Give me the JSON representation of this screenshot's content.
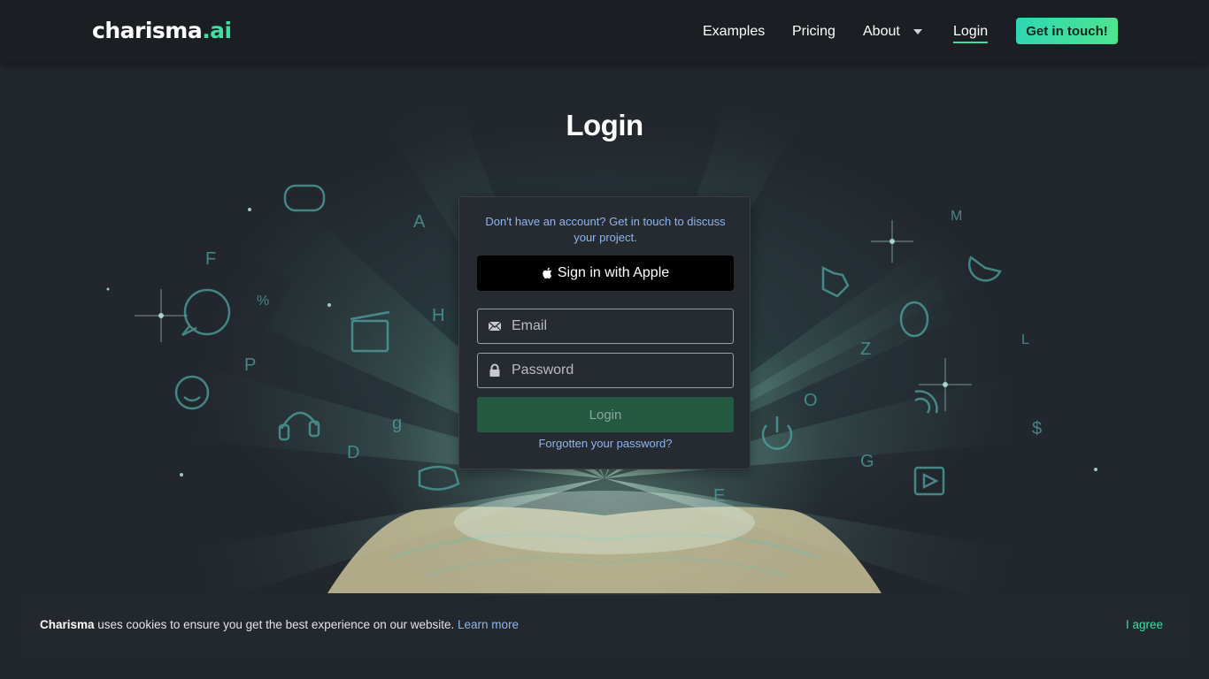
{
  "brand": {
    "name_main": "charisma",
    "name_accent": ".ai"
  },
  "nav": {
    "examples": "Examples",
    "pricing": "Pricing",
    "about": "About",
    "login": "Login",
    "cta": "Get in touch!"
  },
  "page": {
    "title": "Login"
  },
  "form": {
    "note": "Don't have an account? Get in touch to discuss your project.",
    "apple_label": "Sign in with Apple",
    "email_placeholder": "Email",
    "password_placeholder": "Password",
    "submit_label": "Login",
    "forgot_label": "Forgotten your password?"
  },
  "cookie": {
    "brand": "Charisma",
    "message": " uses cookies to ensure you get the best experience on our website. ",
    "learn_more": "Learn more",
    "agree": "I agree"
  },
  "colors": {
    "accent": "#3ce0a3",
    "link": "#8fb6ec",
    "background": "#22262d",
    "header": "#1b1e23",
    "login_button": "#245a42"
  },
  "icons": [
    "apple-icon",
    "email-icon",
    "lock-icon",
    "caret-down-icon"
  ]
}
